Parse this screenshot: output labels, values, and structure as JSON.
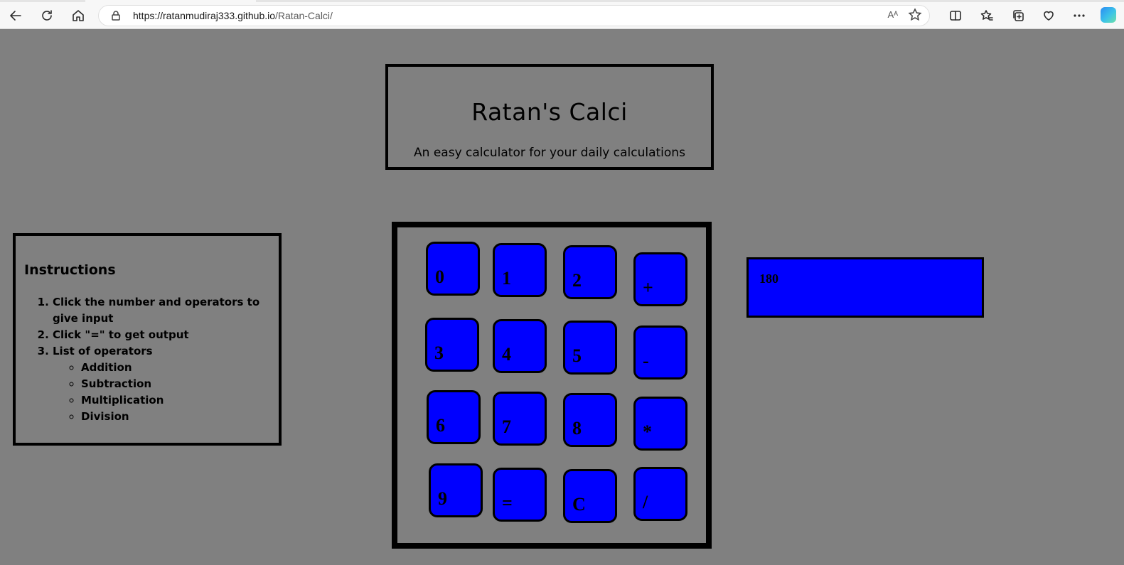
{
  "browser": {
    "url_host": "https://ratanmudiraj333.github.io",
    "url_path": "/Ratan-Calci/",
    "read_aloud_label": "Aᴬ"
  },
  "header": {
    "title": "Ratan's Calci",
    "subtitle": "An easy calculator for your daily calculations"
  },
  "instructions": {
    "heading": "Instructions",
    "steps": [
      "Click the number and operators to give input",
      "Click \"=\" to get output",
      "List of operators"
    ],
    "operators": [
      "Addition",
      "Subtraction",
      "Multiplication",
      "Division"
    ]
  },
  "calculator": {
    "keys": [
      "0",
      "1",
      "2",
      "+",
      "3",
      "4",
      "5",
      "-",
      "6",
      "7",
      "8",
      "*",
      "9",
      "=",
      "C",
      "/"
    ],
    "display_value": "180"
  },
  "colors": {
    "page_background": "#808080",
    "key_fill": "#0000ff",
    "border": "#000000"
  }
}
